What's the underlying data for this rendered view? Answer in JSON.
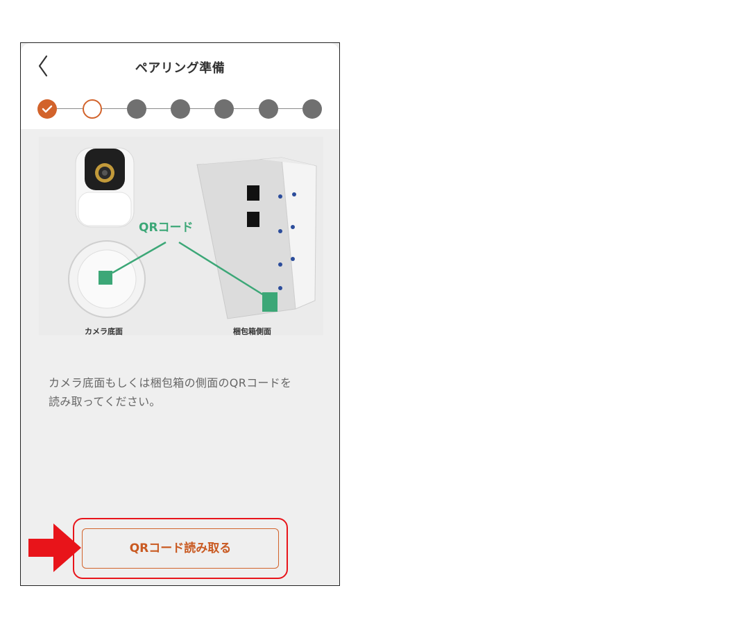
{
  "header": {
    "title": "ペアリング準備",
    "back_icon": "chevron-left-icon"
  },
  "stepper": {
    "steps": [
      "done",
      "current",
      "todo",
      "todo",
      "todo",
      "todo",
      "todo"
    ],
    "current_step": 2,
    "total_steps": 7
  },
  "illustration": {
    "qr_label": "QRコード",
    "camera_caption": "カメラ底面",
    "box_caption": "梱包箱側面"
  },
  "instruction": {
    "line1": "カメラ底面もしくは梱包箱の側面のQRコードを",
    "line2": "読み取ってください。"
  },
  "action": {
    "qr_button_label": "QRコード読み取る"
  },
  "colors": {
    "accent": "#d2632b",
    "qr_green": "#3ca777",
    "annotation_red": "#e8141a",
    "step_inactive": "#707070"
  }
}
